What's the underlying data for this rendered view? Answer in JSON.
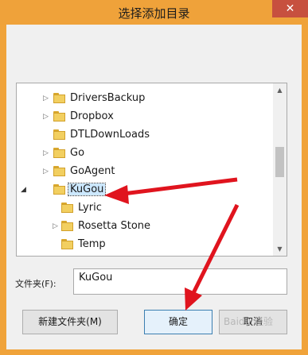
{
  "window": {
    "title": "选择添加目录",
    "close_glyph": "✕"
  },
  "tree": {
    "items": [
      {
        "label": "DriversBackup",
        "expander": "▷",
        "selected": false
      },
      {
        "label": "Dropbox",
        "expander": "▷",
        "selected": false
      },
      {
        "label": "DTLDownLoads",
        "expander": "",
        "selected": false
      },
      {
        "label": "Go",
        "expander": "▷",
        "selected": false
      },
      {
        "label": "GoAgent",
        "expander": "▷",
        "selected": false
      },
      {
        "label": "KuGou",
        "expander": "◢",
        "selected": true
      },
      {
        "label": "Lyric",
        "expander": "",
        "selected": false
      },
      {
        "label": "Rosetta Stone",
        "expander": "▷",
        "selected": false
      },
      {
        "label": "Temp",
        "expander": "",
        "selected": false
      }
    ],
    "scroll_up_glyph": "▲",
    "scroll_down_glyph": "▼"
  },
  "folder_field": {
    "label": "文件夹(F):",
    "value": "KuGou"
  },
  "buttons": {
    "new_folder": "新建文件夹(M)",
    "ok": "确定",
    "cancel": "取消"
  },
  "watermark": {
    "text": "Baidu 经验"
  },
  "colors": {
    "frame": "#f0a33a",
    "close": "#c7503f",
    "arrow": "#e0141e",
    "selection_border": "#3c7fb1"
  }
}
